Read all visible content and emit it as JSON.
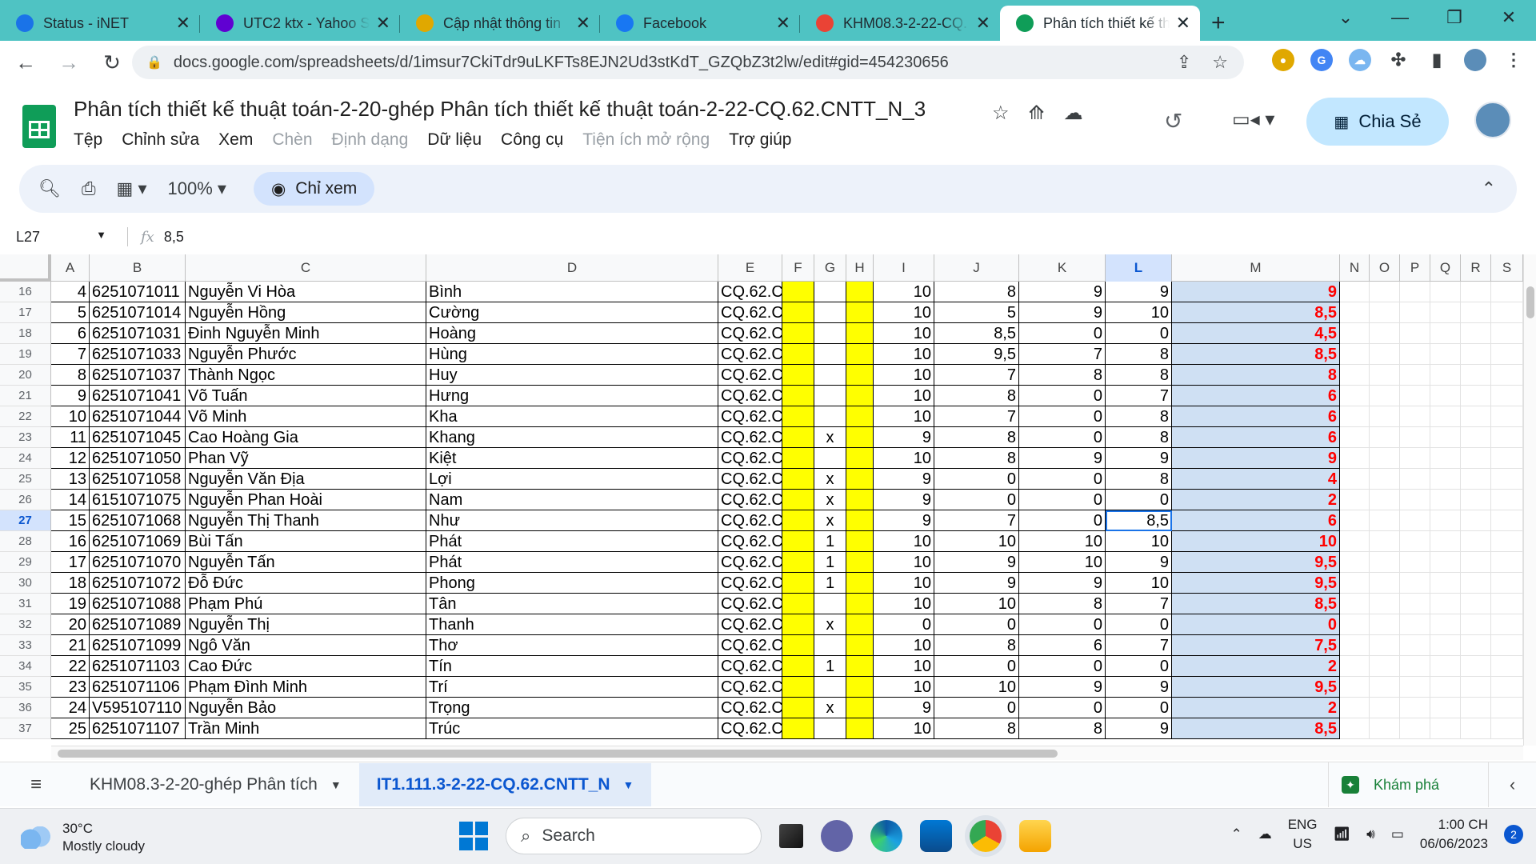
{
  "browser": {
    "tabs": [
      {
        "title": "Status - iNET",
        "favicon_color": "#1a73e8",
        "icon": "wifi-icon"
      },
      {
        "title": "UTC2 ktx - Yahoo S",
        "favicon_color": "#6001d2",
        "icon": "yahoo-icon"
      },
      {
        "title": "Cập nhật thông tin",
        "favicon_color": "#e0a800",
        "icon": "utc-logo-icon"
      },
      {
        "title": "Facebook",
        "favicon_color": "#1877f2",
        "icon": "facebook-icon"
      },
      {
        "title": "KHM08.3-2-22-CQ.",
        "favicon_color": "#ea4335",
        "icon": "gmail-icon"
      },
      {
        "title": "Phân tích thiết kế th",
        "favicon_color": "#0f9d58",
        "icon": "sheets-icon"
      }
    ],
    "url": "docs.google.com/spreadsheets/d/1imsur7CkiTdr9uLKFTs8EJN2Ud3stKdT_GZQbZ3t2lw/edit#gid=454230656"
  },
  "doc": {
    "title": "Phân tích thiết kế thuật toán-2-20-ghép Phân tích thiết kế thuật toán-2-22-CQ.62.CNTT_N_3",
    "menu": [
      "Tệp",
      "Chỉnh sửa",
      "Xem",
      "Chèn",
      "Định dạng",
      "Dữ liệu",
      "Công cụ",
      "Tiện ích mở rộng",
      "Trợ giúp"
    ],
    "menu_disabled": [
      false,
      false,
      false,
      true,
      true,
      false,
      false,
      true,
      false
    ],
    "share_label": "Chia Sẻ",
    "zoom": "100%",
    "view_only_label": "Chỉ xem"
  },
  "formula": {
    "cell_ref": "L27",
    "value": "8,5"
  },
  "columns": [
    "A",
    "B",
    "C",
    "D",
    "E",
    "F",
    "G",
    "H",
    "I",
    "J",
    "K",
    "L",
    "M",
    "N",
    "O",
    "P",
    "Q",
    "R",
    "S"
  ],
  "selected_column": "L",
  "selected_row": "27",
  "rows": [
    {
      "n": "16",
      "a": "4",
      "b": "6251071011",
      "c": "Nguyễn Vi Hòa",
      "d": "Bình",
      "e": "CQ.62.C",
      "g": "",
      "i": "10",
      "j": "8",
      "k": "9",
      "l": "9",
      "m": "9"
    },
    {
      "n": "17",
      "a": "5",
      "b": "6251071014",
      "c": "Nguyễn Hồng",
      "d": "Cường",
      "e": "CQ.62.C",
      "g": "",
      "i": "10",
      "j": "5",
      "k": "9",
      "l": "10",
      "m": "8,5"
    },
    {
      "n": "18",
      "a": "6",
      "b": "6251071031",
      "c": "Đinh Nguyễn Minh",
      "d": "Hoàng",
      "e": "CQ.62.C",
      "g": "",
      "i": "10",
      "j": "8,5",
      "k": "0",
      "l": "0",
      "m": "4,5"
    },
    {
      "n": "19",
      "a": "7",
      "b": "6251071033",
      "c": "Nguyễn Phước",
      "d": "Hùng",
      "e": "CQ.62.C",
      "g": "",
      "i": "10",
      "j": "9,5",
      "k": "7",
      "l": "8",
      "m": "8,5"
    },
    {
      "n": "20",
      "a": "8",
      "b": "6251071037",
      "c": "Thành Ngọc",
      "d": "Huy",
      "e": "CQ.62.C",
      "g": "",
      "i": "10",
      "j": "7",
      "k": "8",
      "l": "8",
      "m": "8"
    },
    {
      "n": "21",
      "a": "9",
      "b": "6251071041",
      "c": "Võ Tuấn",
      "d": "Hưng",
      "e": "CQ.62.C",
      "g": "",
      "i": "10",
      "j": "8",
      "k": "0",
      "l": "7",
      "m": "6"
    },
    {
      "n": "22",
      "a": "10",
      "b": "6251071044",
      "c": "Võ Minh",
      "d": "Kha",
      "e": "CQ.62.C",
      "g": "",
      "i": "10",
      "j": "7",
      "k": "0",
      "l": "8",
      "m": "6"
    },
    {
      "n": "23",
      "a": "11",
      "b": "6251071045",
      "c": "Cao Hoàng Gia",
      "d": "Khang",
      "e": "CQ.62.C",
      "g": "x",
      "i": "9",
      "j": "8",
      "k": "0",
      "l": "8",
      "m": "6"
    },
    {
      "n": "24",
      "a": "12",
      "b": "6251071050",
      "c": "Phan Vỹ",
      "d": "Kiệt",
      "e": "CQ.62.C",
      "g": "",
      "i": "10",
      "j": "8",
      "k": "9",
      "l": "9",
      "m": "9"
    },
    {
      "n": "25",
      "a": "13",
      "b": "6251071058",
      "c": "Nguyễn Văn Địa",
      "d": "Lợi",
      "e": "CQ.62.C",
      "g": "x",
      "i": "9",
      "j": "0",
      "k": "0",
      "l": "8",
      "m": "4"
    },
    {
      "n": "26",
      "a": "14",
      "b": "6151071075",
      "c": "Nguyễn Phan Hoài",
      "d": "Nam",
      "e": "CQ.62.C",
      "g": "x",
      "i": "9",
      "j": "0",
      "k": "0",
      "l": "0",
      "m": "2"
    },
    {
      "n": "27",
      "a": "15",
      "b": "6251071068",
      "c": "Nguyễn Thị Thanh",
      "d": "Như",
      "e": "CQ.62.C",
      "g": "x",
      "i": "9",
      "j": "7",
      "k": "0",
      "l": "8,5",
      "m": "6"
    },
    {
      "n": "28",
      "a": "16",
      "b": "6251071069",
      "c": "Bùi Tấn",
      "d": "Phát",
      "e": "CQ.62.C",
      "g": "1",
      "i": "10",
      "j": "10",
      "k": "10",
      "l": "10",
      "m": "10"
    },
    {
      "n": "29",
      "a": "17",
      "b": "6251071070",
      "c": "Nguyễn Tấn",
      "d": "Phát",
      "e": "CQ.62.C",
      "g": "1",
      "i": "10",
      "j": "9",
      "k": "10",
      "l": "9",
      "m": "9,5"
    },
    {
      "n": "30",
      "a": "18",
      "b": "6251071072",
      "c": "Đỗ Đức",
      "d": "Phong",
      "e": "CQ.62.C",
      "g": "1",
      "i": "10",
      "j": "9",
      "k": "9",
      "l": "10",
      "m": "9,5"
    },
    {
      "n": "31",
      "a": "19",
      "b": "6251071088",
      "c": "Phạm Phú",
      "d": "Tân",
      "e": "CQ.62.C",
      "g": "",
      "i": "10",
      "j": "10",
      "k": "8",
      "l": "7",
      "m": "8,5"
    },
    {
      "n": "32",
      "a": "20",
      "b": "6251071089",
      "c": "Nguyễn Thị",
      "d": "Thanh",
      "e": "CQ.62.C",
      "g": "x",
      "i": "0",
      "j": "0",
      "k": "0",
      "l": "0",
      "m": "0"
    },
    {
      "n": "33",
      "a": "21",
      "b": "6251071099",
      "c": "Ngô Văn",
      "d": "Thơ",
      "e": "CQ.62.C",
      "g": "",
      "i": "10",
      "j": "8",
      "k": "6",
      "l": "7",
      "m": "7,5"
    },
    {
      "n": "34",
      "a": "22",
      "b": "6251071103",
      "c": "Cao Đức",
      "d": "Tín",
      "e": "CQ.62.C",
      "g": "1",
      "i": "10",
      "j": "0",
      "k": "0",
      "l": "0",
      "m": "2"
    },
    {
      "n": "35",
      "a": "23",
      "b": "6251071106",
      "c": "Phạm Đình Minh",
      "d": "Trí",
      "e": "CQ.62.C",
      "g": "",
      "i": "10",
      "j": "10",
      "k": "9",
      "l": "9",
      "m": "9,5"
    },
    {
      "n": "36",
      "a": "24",
      "b": "V595107110",
      "c": "Nguyễn Bảo",
      "d": "Trọng",
      "e": "CQ.62.C",
      "g": "x",
      "i": "9",
      "j": "0",
      "k": "0",
      "l": "0",
      "m": "2"
    },
    {
      "n": "37",
      "a": "25",
      "b": "6251071107",
      "c": "Trần Minh",
      "d": "Trúc",
      "e": "CQ.62.C",
      "g": "",
      "i": "10",
      "j": "8",
      "k": "8",
      "l": "9",
      "m": "8,5"
    }
  ],
  "sheet_tabs": [
    {
      "label": "KHM08.3-2-20-ghép Phân tích",
      "active": false
    },
    {
      "label": "IT1.111.3-2-22-CQ.62.CNTT_N",
      "active": true
    }
  ],
  "explore_label": "Khám phá",
  "taskbar": {
    "weather_temp": "30°C",
    "weather_desc": "Mostly cloudy",
    "search_label": "Search",
    "lang_1": "ENG",
    "lang_2": "US",
    "time": "1:00 CH",
    "date": "06/06/2023",
    "notifications": "2"
  }
}
